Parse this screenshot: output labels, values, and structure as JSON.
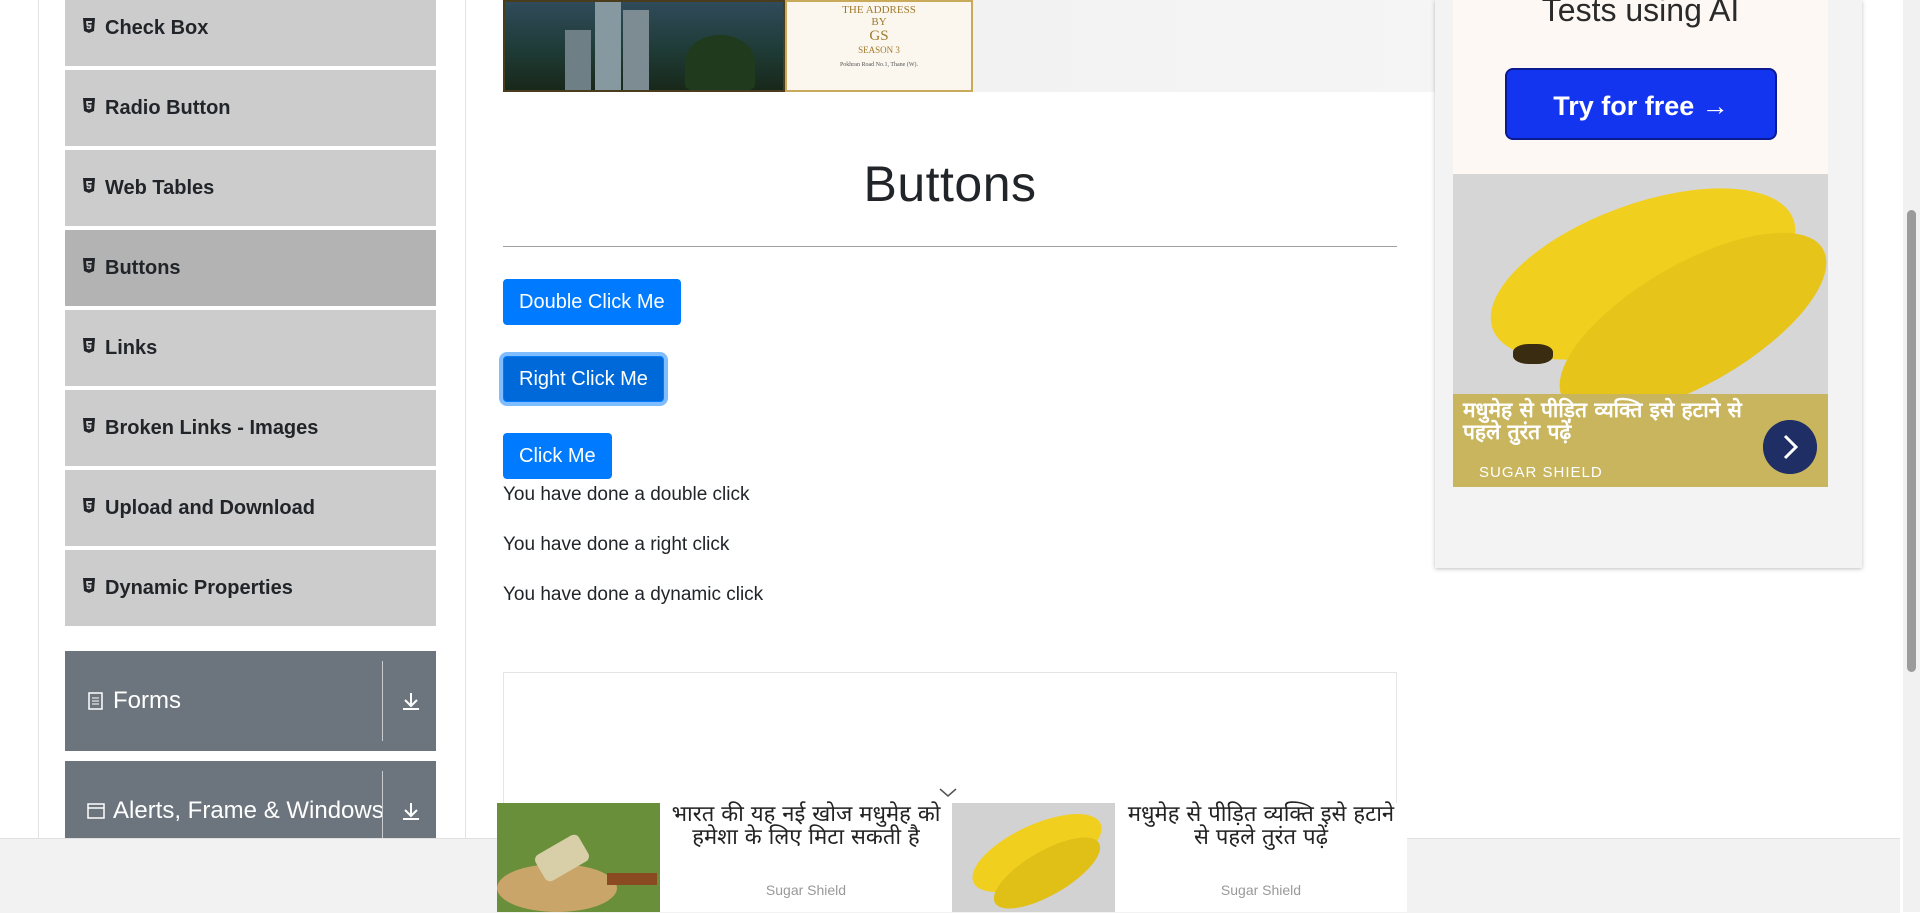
{
  "sidebar": {
    "items": [
      {
        "label": "Check Box"
      },
      {
        "label": "Radio Button"
      },
      {
        "label": "Web Tables"
      },
      {
        "label": "Buttons"
      },
      {
        "label": "Links"
      },
      {
        "label": "Broken Links - Images"
      },
      {
        "label": "Upload and Download"
      },
      {
        "label": "Dynamic Properties"
      }
    ],
    "groups": [
      {
        "label": "Forms"
      },
      {
        "label": "Alerts, Frame & Windows"
      }
    ]
  },
  "banner": {
    "line1": "THE ADDRESS",
    "line2": "BY",
    "line3": "GS",
    "line4": "SEASON 3",
    "location": "Pokhran Road No.1, Thane (W)."
  },
  "main": {
    "title": "Buttons",
    "buttons": {
      "double_click": "Double Click Me",
      "right_click": "Right Click Me",
      "click": "Click Me"
    },
    "messages": {
      "double": "You have done a double click",
      "right": "You have done a right click",
      "dynamic": "You have done a dynamic click"
    }
  },
  "right_ad": {
    "headline": "Tests using AI",
    "cta": "Try for free →",
    "caption": "मधुमेह से पीड़ित व्यक्ति इसे हटाने से पहले तुरंत पढ़ें",
    "brand": "SUGAR SHIELD"
  },
  "bottom_ad": {
    "cards": [
      {
        "text": "भारत की यह नई खोज मधुमेह को हमेशा के लिए मिटा सकती है",
        "source": "Sugar Shield"
      },
      {
        "text": "मधुमेह से पीड़ित व्यक्ति इसे हटाने से पहले तुरंत पढ़ें",
        "source": "Sugar Shield"
      }
    ]
  },
  "colors": {
    "primary": "#007bff",
    "sidebar_item": "#cccccc",
    "sidebar_active": "#b3b3b3",
    "group_header": "#6c757d",
    "ad_cta": "#1435f0"
  }
}
